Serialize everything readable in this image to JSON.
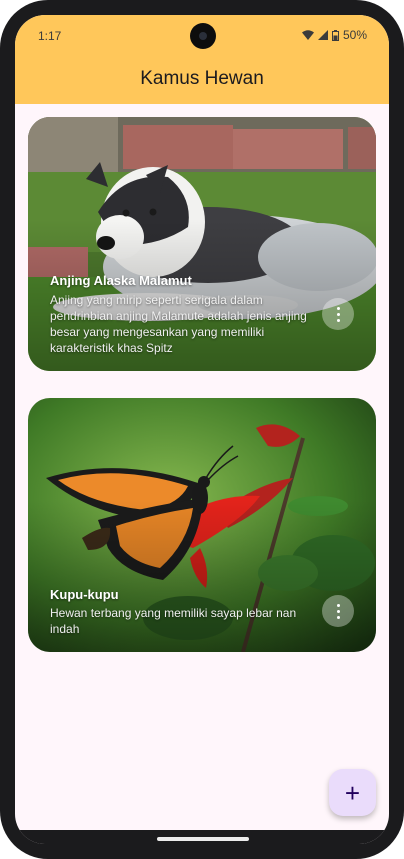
{
  "status": {
    "time": "1:17",
    "battery": "50%",
    "icons": [
      "wifi-icon",
      "signal-icon",
      "battery-icon"
    ]
  },
  "appbar": {
    "title": "Kamus Hewan",
    "color": "#ffc75a"
  },
  "cards": [
    {
      "title": "Anjing Alaska Malamut",
      "description": "Anjing yang mirip seperti serigala dalam pendrinbian anjing Malamute adalah jenis anjing besar yang mengesankan yang memiliki karakteristik khas Spitz",
      "image": "alaskan-malamute-photo",
      "menu_icon": "more-vert-icon"
    },
    {
      "title": "Kupu-kupu",
      "description": "Hewan terbang yang memiliki sayap lebar nan indah",
      "image": "monarch-butterfly-photo",
      "menu_icon": "more-vert-icon"
    }
  ],
  "fab": {
    "label": "+",
    "icon": "add-icon",
    "color": "#eadcfb"
  }
}
